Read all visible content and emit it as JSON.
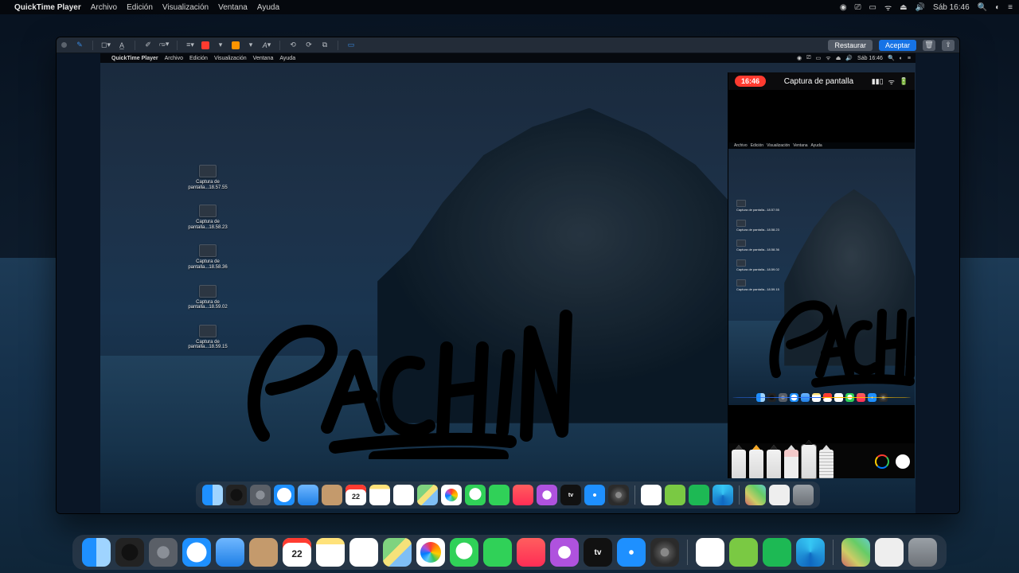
{
  "outer_menu": {
    "app": "QuickTime Player",
    "items": [
      "Archivo",
      "Edición",
      "Visualización",
      "Ventana",
      "Ayuda"
    ],
    "clock": "Sáb 16:46"
  },
  "markup": {
    "restore": "Restaurar",
    "accept": "Aceptar",
    "stroke_color": "#ff3b30",
    "fill_color": "#ff9500"
  },
  "inner_menu": {
    "app": "QuickTime Player",
    "items": [
      "Archivo",
      "Edición",
      "Visualización",
      "Ventana",
      "Ayuda"
    ],
    "clock": "Sáb 16:46"
  },
  "desktop_icons": [
    "Captura de\npantalla...18.57.55",
    "Captura de\npantalla...18.58.23",
    "Captura de\npantalla...18.58.36",
    "Captura de\npantalla...18.59.02",
    "Captura de\npantalla...18.59.15"
  ],
  "handwriting_text": "PACHIN",
  "ipad": {
    "time": "16:46",
    "title": "Captura de pantalla",
    "mini_menu": [
      "Archivo",
      "Edición",
      "Visualización",
      "Ventana",
      "Ayuda"
    ]
  },
  "calendar_day": "22",
  "dock_apps": [
    "finder",
    "siri",
    "launchpad",
    "safari",
    "mail",
    "contacts",
    "calendar",
    "notes",
    "reminders",
    "maps",
    "photos",
    "messages",
    "facetime",
    "music",
    "podcasts",
    "tv",
    "appstore",
    "settings"
  ],
  "dock_extra": [
    "mic",
    "camtasia",
    "spotify",
    "edge"
  ],
  "dock_right": [
    "stack1",
    "stack2",
    "trash"
  ]
}
